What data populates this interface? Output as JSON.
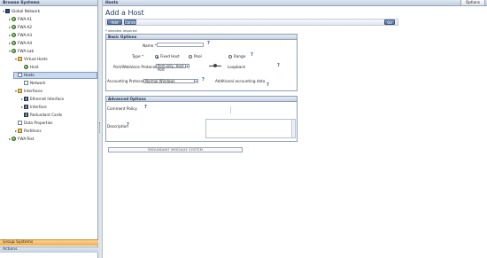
{
  "sidebar": {
    "header": "Browse Systems",
    "tree": [
      {
        "label": "Global Network",
        "icon": "root-icon",
        "toggle": "▾",
        "depth": 0
      },
      {
        "label": "FWA-A1",
        "icon": "host-icon",
        "toggle": "▸",
        "depth": 1
      },
      {
        "label": "FWA-A2",
        "icon": "host-icon",
        "toggle": "▸",
        "depth": 1
      },
      {
        "label": "FWA-A3",
        "icon": "host-icon",
        "toggle": "▸",
        "depth": 1
      },
      {
        "label": "FWA-A4",
        "icon": "host-icon",
        "toggle": "▸",
        "depth": 1
      },
      {
        "label": "FWA-Lab",
        "icon": "host-icon",
        "toggle": "▾",
        "depth": 1
      },
      {
        "label": "Virtual Hosts",
        "icon": "folder-icon",
        "toggle": "▾",
        "depth": 2
      },
      {
        "label": "Host",
        "icon": "host-icon",
        "toggle": "",
        "depth": 3
      },
      {
        "label": "Hosts",
        "icon": "page-icon",
        "toggle": "",
        "depth": 2,
        "selected": true
      },
      {
        "label": "Network",
        "icon": "page-icon",
        "toggle": "",
        "depth": 3
      },
      {
        "label": "Interfaces",
        "icon": "folder-icon",
        "toggle": "▾",
        "depth": 2
      },
      {
        "label": "Ethernet Interface",
        "icon": "net-icon",
        "toggle": "▸",
        "depth": 3
      },
      {
        "label": "Interface",
        "icon": "net-icon",
        "toggle": "▸",
        "depth": 3
      },
      {
        "label": "Redundant Cards",
        "icon": "net-icon",
        "toggle": "",
        "depth": 3
      },
      {
        "label": "Data Properties",
        "icon": "page-icon",
        "toggle": "",
        "depth": 2
      },
      {
        "label": "Partitions",
        "icon": "folder-icon",
        "toggle": "▸",
        "depth": 2
      },
      {
        "label": "FWA-Test",
        "icon": "host-icon",
        "toggle": "▸",
        "depth": 1
      }
    ],
    "acc_active": "Group Systems",
    "acc_other": "Actions"
  },
  "main": {
    "header": "Hosts",
    "options_label": "Options",
    "title": "Add a Host",
    "buttons": {
      "add": "Add Host",
      "cancel": "Cancel",
      "right": "Go"
    },
    "required_note": "* denotes required",
    "basic": {
      "title": "Basic Options",
      "name_label": "Name *",
      "type_label": "Type *",
      "radios": [
        {
          "label": "Fixed Host",
          "checked": true
        },
        {
          "label": "Pool",
          "checked": false
        },
        {
          "label": "Range",
          "checked": false
        }
      ],
      "port_label": "Port/WebVoice Protocol *",
      "port_value": "Port-only, Host Port",
      "loopback_label": "Loopback",
      "protocol_label": "Accounting Protocol *",
      "protocol_value": "Normal Windows",
      "extra_label": "Additional accounting data"
    },
    "advanced": {
      "title": "Advanced Options",
      "comment_label": "Comment Policy",
      "desc_label": "Description"
    },
    "redundant_bar": "REDUNDANT MESSAGE SYSTEM"
  }
}
